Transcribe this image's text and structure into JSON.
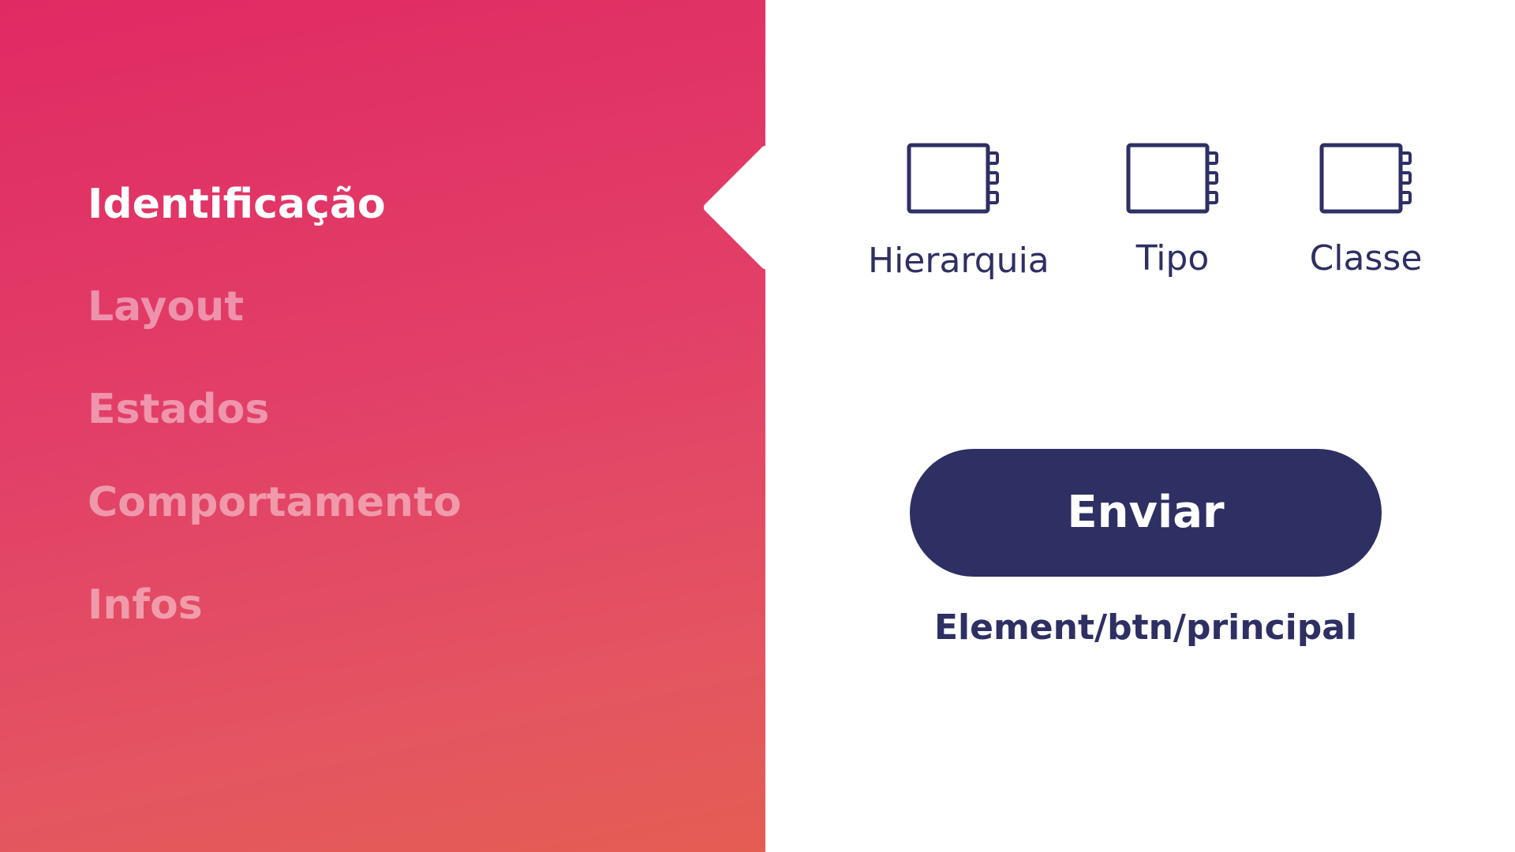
{
  "sidebar": {
    "items": [
      {
        "label": "Identificação",
        "active": true
      },
      {
        "label": "Layout",
        "active": false
      },
      {
        "label": "Estados",
        "active": false
      },
      {
        "label": "Comportamento",
        "active": false
      },
      {
        "label": "Infos",
        "active": false
      }
    ]
  },
  "options": [
    {
      "label": "Hierarquia",
      "icon": "notebook-icon"
    },
    {
      "label": "Tipo",
      "icon": "notebook-icon"
    },
    {
      "label": "Classe",
      "icon": "notebook-icon"
    }
  ],
  "button": {
    "label": "Enviar"
  },
  "component_path": "Element/btn/principal",
  "colors": {
    "gradient_top": "#e02a63",
    "gradient_bottom": "#e45d53",
    "primary": "#2e2f63",
    "inactive_text": "rgba(255,255,255,0.45)"
  }
}
